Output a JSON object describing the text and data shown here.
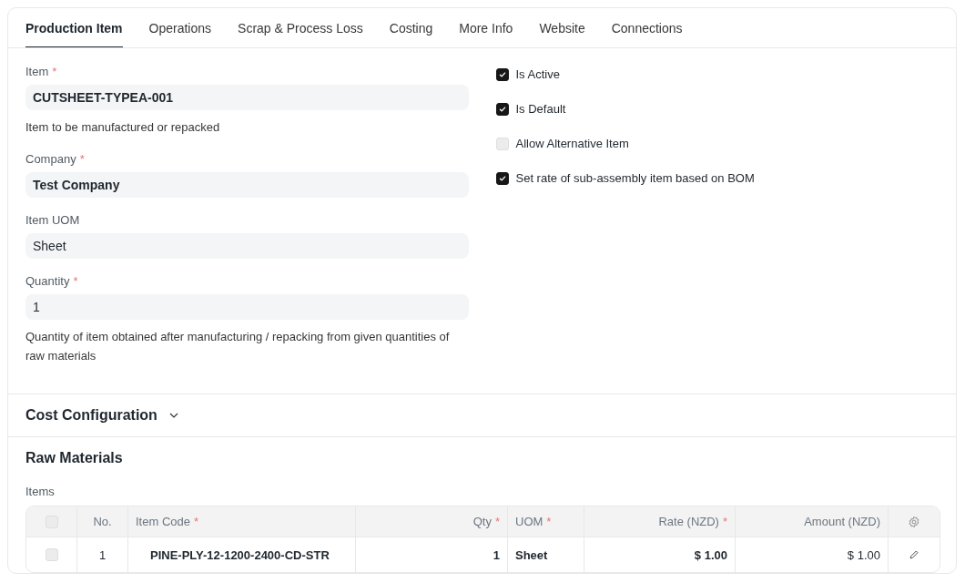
{
  "tabs": [
    {
      "label": "Production Item",
      "selected": true
    },
    {
      "label": "Operations",
      "selected": false
    },
    {
      "label": "Scrap & Process Loss",
      "selected": false
    },
    {
      "label": "Costing",
      "selected": false
    },
    {
      "label": "More Info",
      "selected": false
    },
    {
      "label": "Website",
      "selected": false
    },
    {
      "label": "Connections",
      "selected": false
    }
  ],
  "fields": [
    {
      "label": "Item",
      "required_mark": "*",
      "value": "CUTSHEET-TYPEA-001",
      "bold": true,
      "description": "Item to be manufactured or repacked"
    },
    {
      "label": "Company",
      "required_mark": "*",
      "value": "Test Company",
      "bold": true
    },
    {
      "label": "Item UOM",
      "value": "Sheet",
      "bold": false
    },
    {
      "label": "Quantity",
      "required_mark": "*",
      "value": "1",
      "bold": false,
      "description": "Quantity of item obtained after manufacturing / repacking from given quantities of raw materials"
    }
  ],
  "checkboxes": [
    {
      "label": "Is Active",
      "checked": true
    },
    {
      "label": "Is Default",
      "checked": true
    },
    {
      "label": "Allow Alternative Item",
      "checked": false
    },
    {
      "label": "Set rate of sub-assembly item based on BOM",
      "checked": true
    }
  ],
  "cost_section": {
    "title": "Cost Configuration",
    "expanded": false
  },
  "raw_materials": {
    "title": "Raw Materials",
    "table_label": "Items",
    "header_checked": false,
    "columns": [
      {
        "label": "No."
      },
      {
        "label": "Item Code",
        "required_mark": "*"
      },
      {
        "label": "Qty",
        "required_mark": "*"
      },
      {
        "label": "UOM",
        "required_mark": "*"
      },
      {
        "label": "Rate (NZD)",
        "required_mark": "*"
      },
      {
        "label": "Amount (NZD)"
      }
    ],
    "rows": [
      {
        "checked": false,
        "cells": [
          "1",
          "PINE-PLY-12-1200-2400-CD-STR",
          "1",
          "Sheet",
          "$ 1.00",
          "$ 1.00"
        ]
      }
    ]
  }
}
